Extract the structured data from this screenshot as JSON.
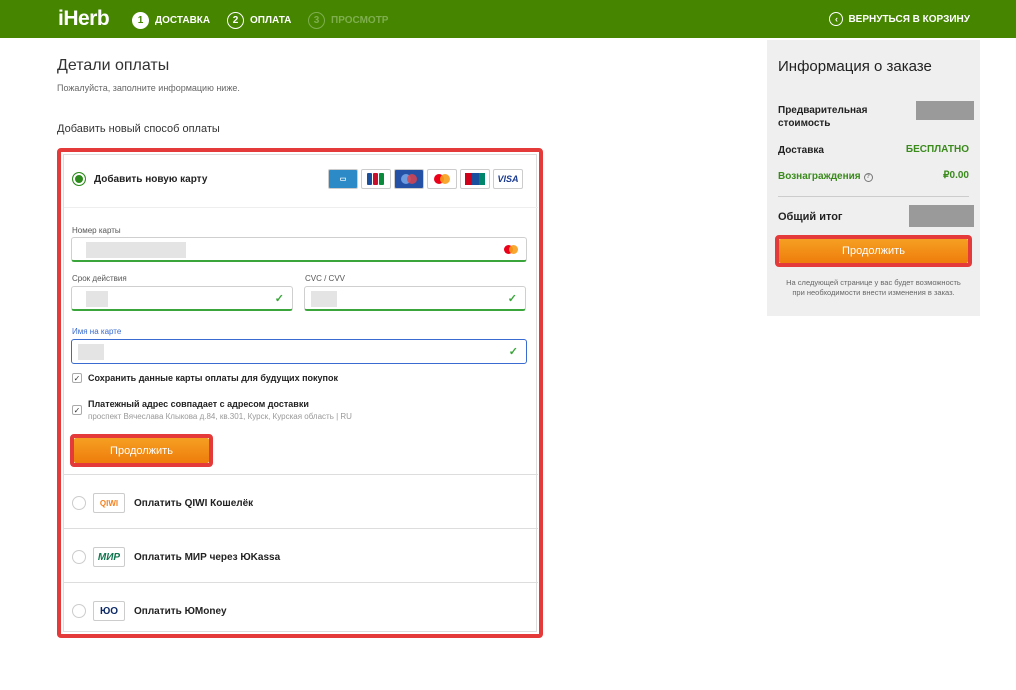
{
  "header": {
    "logo": "iHerb",
    "steps": [
      {
        "num": "1",
        "label": "ДОСТАВКА"
      },
      {
        "num": "2",
        "label": "ОПЛАТА"
      },
      {
        "num": "3",
        "label": "ПРОСМОТР"
      }
    ],
    "back_label": "ВЕРНУТЬСЯ В КОРЗИНУ"
  },
  "payment": {
    "title": "Детали оплаты",
    "subtitle": "Пожалуйста, заполните информацию ниже.",
    "section_label": "Добавить новый способ оплаты",
    "add_card_label": "Добавить новую карту",
    "card_icons": [
      "amex-icon",
      "jcb-icon",
      "maestro-icon",
      "mastercard-icon",
      "unionpay-icon",
      "visa-icon"
    ],
    "visa_text": "VISA",
    "fields": {
      "card_number_label": "Номер карты",
      "expiry_label": "Срок действия",
      "cvc_label": "CVC / CVV",
      "name_label": "Имя на карте"
    },
    "save_card_label": "Сохранить данные карты оплаты для будущих покупок",
    "billing_same_label": "Платежный адрес совпадает с адресом доставки",
    "billing_address": "проспект Вячеслава Клыкова д.84, кв.301, Курск, Курская область | RU",
    "continue_label": "Продолжить",
    "methods": [
      {
        "label": "Оплатить QIWI Кошелёк",
        "logo": "QIWI"
      },
      {
        "label": "Оплатить МИР через ЮKassa",
        "logo": "МИР"
      },
      {
        "label": "Оплатить ЮMoney",
        "logo": "ЮО"
      }
    ]
  },
  "summary": {
    "title": "Информация о заказе",
    "subtotal_label": "Предварительная стоимость",
    "shipping_label": "Доставка",
    "shipping_value": "БЕСПЛАТНО",
    "rewards_label": "Вознаграждения",
    "rewards_value": "₽0.00",
    "total_label": "Общий итог",
    "continue_label": "Продолжить",
    "note": "На следующей странице у вас будет возможность при необходимости внести изменения в заказ."
  },
  "colors": {
    "header_green": "#458500",
    "accent_orange": "#ef7d0c",
    "highlight_red": "#e53a3a",
    "ok_green": "#3aa53a"
  }
}
